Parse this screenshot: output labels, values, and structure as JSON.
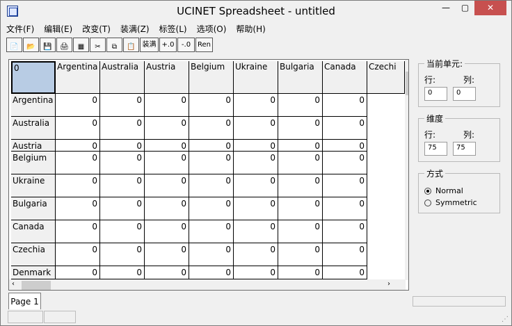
{
  "window": {
    "title": "UCINET Spreadsheet - untitled"
  },
  "menu": [
    "文件(F)",
    "编辑(E)",
    "改变(T)",
    "装满(Z)",
    "标签(L)",
    "选项(O)",
    "帮助(H)"
  ],
  "toolbar": {
    "buttons": [
      "new-icon",
      "open-icon",
      "save-icon",
      "print-icon",
      "view-icon",
      "cut-icon",
      "copy-icon",
      "paste-icon"
    ],
    "text_buttons": [
      "装满",
      "+.0",
      "-.0",
      "Ren"
    ]
  },
  "sheet": {
    "corner": "0",
    "columns": [
      "Argentina",
      "Australia",
      "Austria",
      "Belgium",
      "Ukraine",
      "Bulgaria",
      "Canada",
      "Czechi"
    ],
    "rows": [
      "Argentina",
      "Australia",
      "Austria",
      "Belgium",
      "Ukraine",
      "Bulgaria",
      "Canada",
      "Czechia",
      "Denmark"
    ],
    "cell_value": "0"
  },
  "current_cell": {
    "title": "当前单元:",
    "row_label": "行:",
    "col_label": "列:",
    "row_value": "0",
    "col_value": "0"
  },
  "dimension": {
    "title": "维度",
    "row_label": "行:",
    "col_label": "列:",
    "row_value": "75",
    "col_value": "75"
  },
  "mode": {
    "title": "方式",
    "options": [
      "Normal",
      "Symmetric"
    ],
    "selected": "Normal"
  },
  "tabs": [
    "Page 1"
  ],
  "icons": {
    "app": "ucinet-icon",
    "minimize": "minimize-icon",
    "maximize": "maximize-icon",
    "close": "close-icon",
    "scroll_up": "scroll-up-icon",
    "scroll_down": "scroll-down-icon",
    "scroll_left": "scroll-left-icon",
    "scroll_right": "scroll-right-icon"
  }
}
